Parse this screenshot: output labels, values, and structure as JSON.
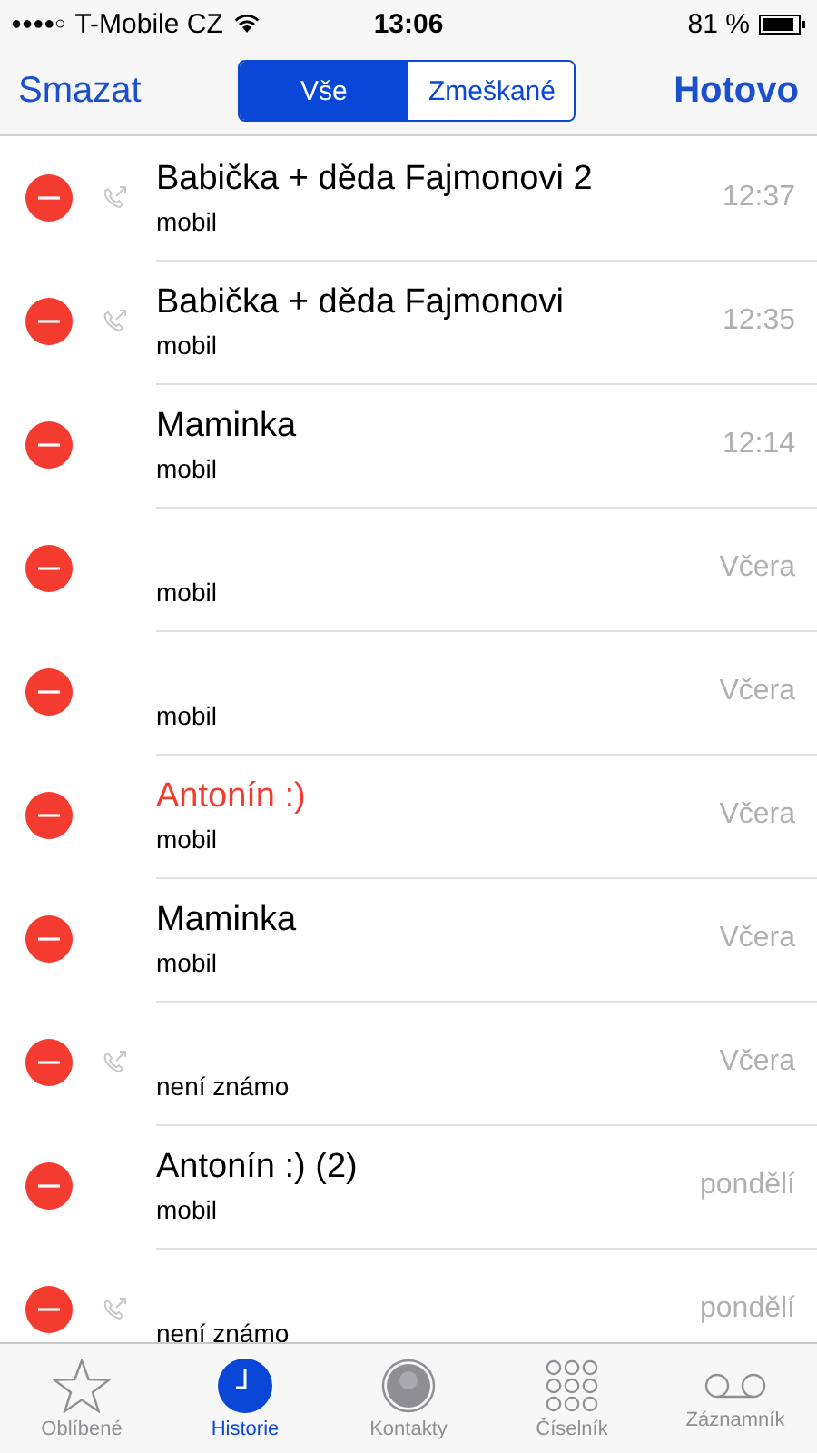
{
  "status_bar": {
    "signal": "●●●●○",
    "carrier": "T-Mobile CZ",
    "time": "13:06",
    "battery": "81 %"
  },
  "nav": {
    "left": "Smazat",
    "right": "Hotovo",
    "segments": [
      {
        "label": "Vše",
        "selected": true
      },
      {
        "label": "Zmeškané",
        "selected": false
      }
    ]
  },
  "calls": [
    {
      "name": "Babička + děda Fajmonovi 2",
      "type": "mobil",
      "time": "12:37",
      "outgoing": true,
      "missed": false
    },
    {
      "name": "Babička + děda Fajmonovi",
      "type": "mobil",
      "time": "12:35",
      "outgoing": true,
      "missed": false
    },
    {
      "name": "Maminka",
      "type": "mobil",
      "time": "12:14",
      "outgoing": false,
      "missed": false
    },
    {
      "type": "mobil",
      "time": "Včera",
      "outgoing": false
    },
    {
      "type": "mobil",
      "time": "Včera",
      "outgoing": false
    },
    {
      "name": "Antonín :)",
      "type": "mobil",
      "time": "Včera",
      "outgoing": false,
      "missed": true
    },
    {
      "name": "Maminka",
      "type": "mobil",
      "time": "Včera",
      "outgoing": false,
      "missed": false
    },
    {
      "type": "není známo",
      "time": "Včera",
      "outgoing": true
    },
    {
      "name": "Antonín :) (2)",
      "type": "mobil",
      "time": "pondělí",
      "outgoing": false,
      "missed": false
    },
    {
      "type": "není známo",
      "time": "pondělí",
      "outgoing": true
    }
  ],
  "tab_bar": [
    {
      "kind": "star",
      "label": "Oblíbené",
      "selected": false
    },
    {
      "kind": "clock",
      "label": "Historie",
      "selected": true
    },
    {
      "kind": "person",
      "label": "Kontakty",
      "selected": false
    },
    {
      "kind": "keypad",
      "label": "Číselník",
      "selected": false
    },
    {
      "kind": "voicemail",
      "label": "Záznamník",
      "selected": false
    }
  ]
}
